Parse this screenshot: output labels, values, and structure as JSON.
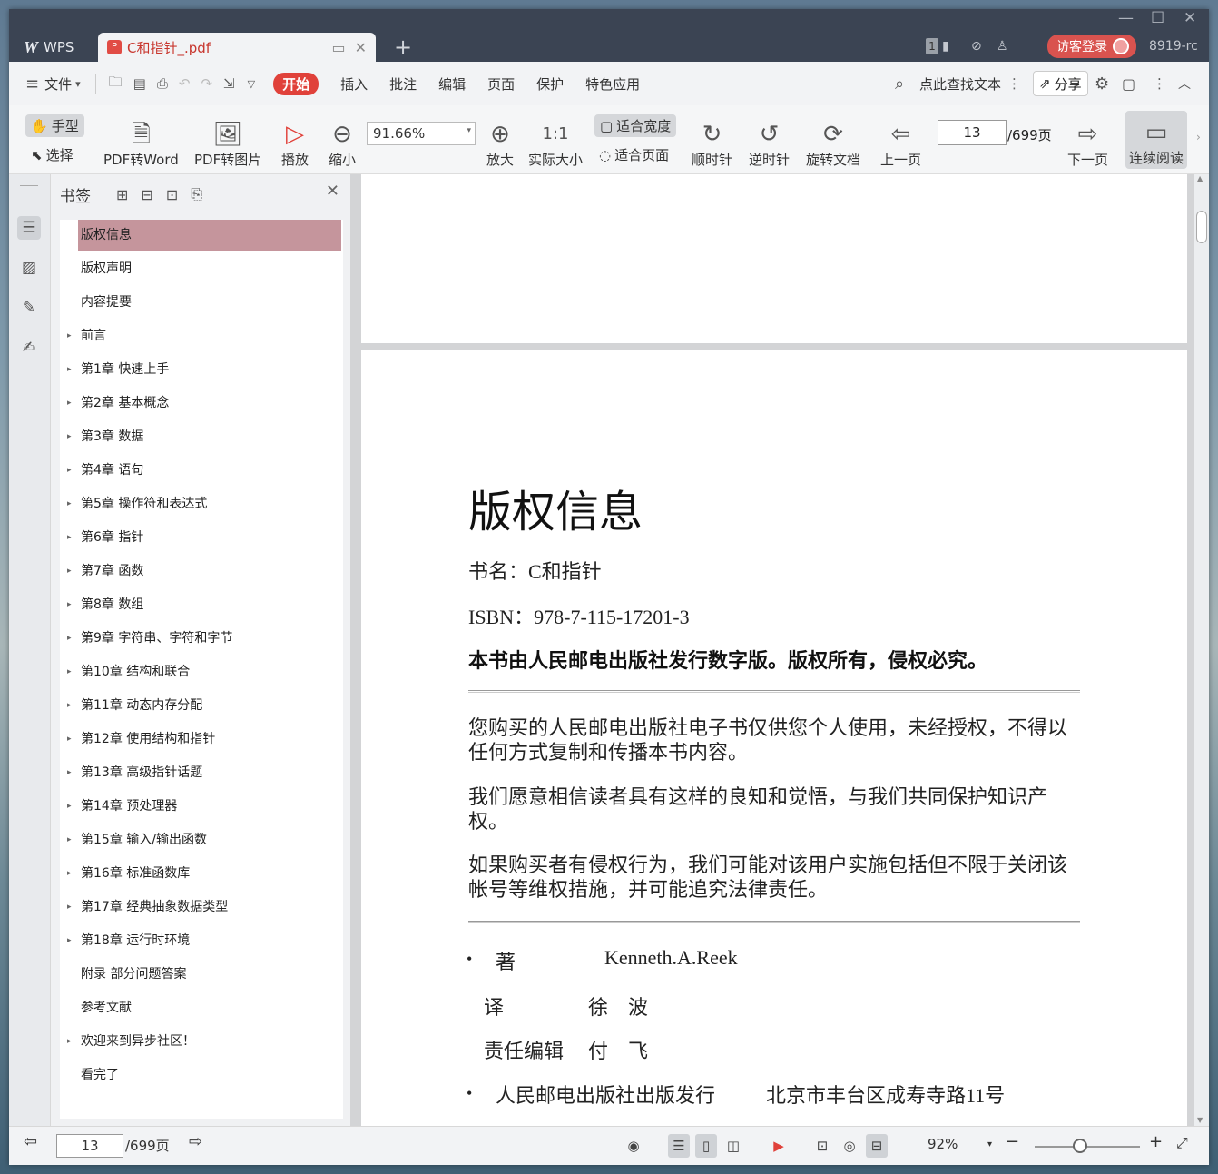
{
  "titlebar": {
    "app_tab": "WPS",
    "doc_tab": "C和指针_.pdf",
    "add_tab": "+",
    "page_badge": "1",
    "login_label": "访客登录",
    "user_id": "8919-rc"
  },
  "menubar": {
    "file": "文件",
    "items": [
      "开始",
      "插入",
      "批注",
      "编辑",
      "页面",
      "保护",
      "特色应用"
    ],
    "search": "点此查找文本",
    "share": "分享"
  },
  "toolbar": {
    "hand": "手型",
    "select": "选择",
    "pdf_word": "PDF转Word",
    "pdf_image": "PDF转图片",
    "play": "播放",
    "zoom_out": "缩小",
    "zoom_value": "91.66%",
    "zoom_in": "放大",
    "actual_size": "实际大小",
    "fit_width": "适合宽度",
    "fit_page": "适合页面",
    "clockwise": "顺时针",
    "counter_clockwise": "逆时针",
    "rotate_doc": "旋转文档",
    "prev_page": "上一页",
    "page_input": "13",
    "page_total": "/699页",
    "next_page": "下一页",
    "continuous": "连续阅读"
  },
  "bookmarks": {
    "title": "书签",
    "items": [
      {
        "label": "版权信息",
        "expandable": false,
        "selected": true
      },
      {
        "label": "版权声明",
        "expandable": false
      },
      {
        "label": "内容提要",
        "expandable": false
      },
      {
        "label": "前言",
        "expandable": true
      },
      {
        "label": "第1章 快速上手",
        "expandable": true
      },
      {
        "label": "第2章 基本概念",
        "expandable": true
      },
      {
        "label": "第3章 数据",
        "expandable": true
      },
      {
        "label": "第4章 语句",
        "expandable": true
      },
      {
        "label": "第5章 操作符和表达式",
        "expandable": true
      },
      {
        "label": "第6章 指针",
        "expandable": true
      },
      {
        "label": "第7章 函数",
        "expandable": true
      },
      {
        "label": "第8章 数组",
        "expandable": true
      },
      {
        "label": "第9章 字符串、字符和字节",
        "expandable": true
      },
      {
        "label": "第10章 结构和联合",
        "expandable": true
      },
      {
        "label": "第11章 动态内存分配",
        "expandable": true
      },
      {
        "label": "第12章 使用结构和指针",
        "expandable": true
      },
      {
        "label": "第13章 高级指针话题",
        "expandable": true
      },
      {
        "label": "第14章 预处理器",
        "expandable": true
      },
      {
        "label": "第15章 输入/输出函数",
        "expandable": true
      },
      {
        "label": "第16章 标准函数库",
        "expandable": true
      },
      {
        "label": "第17章 经典抽象数据类型",
        "expandable": true
      },
      {
        "label": "第18章 运行时环境",
        "expandable": true
      },
      {
        "label": "附录 部分问题答案",
        "expandable": false
      },
      {
        "label": "参考文献",
        "expandable": false
      },
      {
        "label": "欢迎来到异步社区！",
        "expandable": true
      },
      {
        "label": "看完了",
        "expandable": false
      }
    ]
  },
  "document": {
    "heading": "版权信息",
    "book_name": "书名：C和指针",
    "isbn": "ISBN：978-7-115-17201-3",
    "notice": "本书由人民邮电出版社发行数字版。版权所有，侵权必究。",
    "para1": "您购买的人民邮电出版社电子书仅供您个人使用，未经授权，不得以任何方式复制和传播本书内容。",
    "para2": "我们愿意相信读者具有这样的良知和觉悟，与我们共同保护知识产权。",
    "para3": "如果购买者有侵权行为，我们可能对该用户实施包括但不限于关闭该帐号等维权措施，并可能追究法律责任。",
    "author_label": "著",
    "author": "Kenneth.A.Reek",
    "translator_label": "译",
    "translator": "徐　波",
    "editor_label": "责任编辑",
    "editor": "付　飞",
    "publisher": "人民邮电出版社出版发行",
    "address": "北京市丰台区成寿寺路11号"
  },
  "statusbar": {
    "page_input": "13",
    "page_total": "/699页",
    "zoom": "92%"
  },
  "colors": {
    "accent": "#e0413a",
    "selected_bookmark": "#c5959c",
    "titlebar": "#3b4453"
  }
}
